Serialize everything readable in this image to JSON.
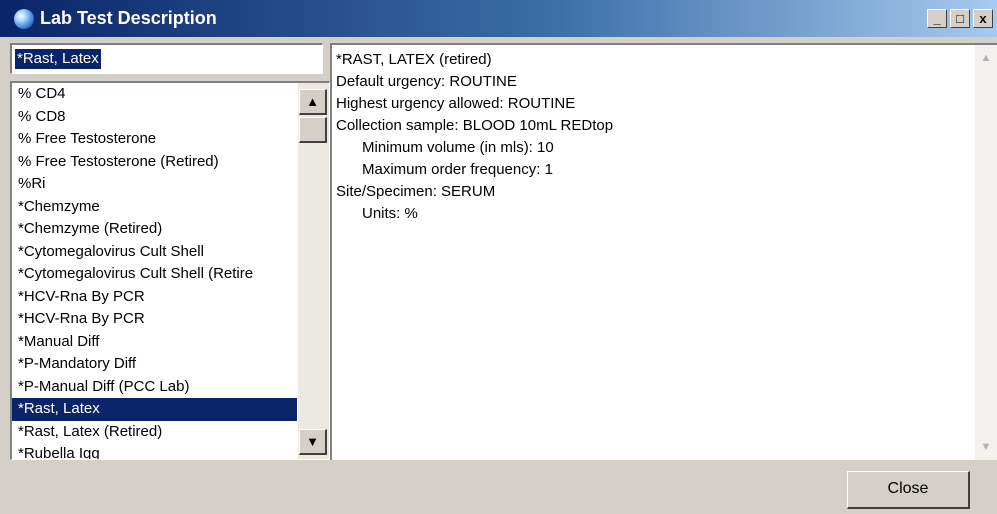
{
  "window": {
    "title": "Lab Test Description",
    "min_label": "_",
    "max_label": "□",
    "close_label": "x"
  },
  "search": {
    "value": "*Rast, Latex"
  },
  "list": {
    "items": [
      "% CD4",
      "% CD8",
      "% Free Testosterone",
      "% Free Testosterone  (Retired)",
      "%Ri",
      "*Chemzyme",
      "*Chemzyme  (Retired)",
      "*Cytomegalovirus Cult Shell",
      "*Cytomegalovirus Cult Shell  (Retire",
      "*HCV-Rna By PCR",
      "*HCV-Rna By PCR",
      "*Manual Diff",
      "*P-Mandatory Diff",
      "*P-Manual Diff (PCC Lab)",
      "*Rast, Latex",
      "*Rast, Latex   (Retired)",
      "*Rubella Igg"
    ],
    "selected_index": 14,
    "scroll_up_glyph": "▲",
    "scroll_down_glyph": "▼"
  },
  "detail": {
    "lines": [
      "*RAST, LATEX   (retired)",
      "Default urgency: ROUTINE",
      "Highest urgency allowed: ROUTINE",
      "Collection sample: BLOOD  10mL REDtop",
      "Minimum volume (in mls): 10",
      "Maximum order frequency: 1",
      "Site/Specimen: SERUM",
      "Units:  %"
    ],
    "scroll_up_glyph": "▲",
    "scroll_down_glyph": "▼"
  },
  "buttons": {
    "close_label": "Close"
  },
  "colors": {
    "selection": "#0a246a",
    "titlebar_start": "#0a246a",
    "titlebar_end": "#a6caf0",
    "face": "#d4d0c8"
  }
}
